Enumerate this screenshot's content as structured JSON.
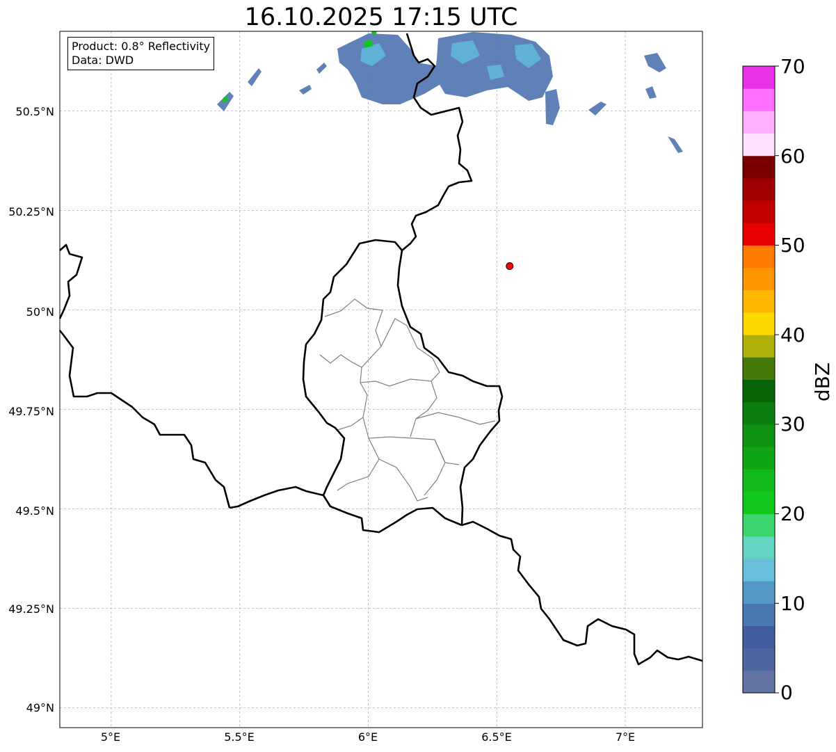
{
  "map": {
    "title": "16.10.2025 17:15 UTC",
    "info": {
      "product": "Product: 0.8° Reflectivity",
      "data": "Data: DWD"
    },
    "extent": {
      "lon_min": 4.8,
      "lon_max": 7.3,
      "lat_min": 48.95,
      "lat_max": 50.7
    },
    "gridlines": true,
    "lat_ticks": [
      {
        "value": 50.5,
        "label": "50.5°N"
      },
      {
        "value": 50.25,
        "label": "50.25°N"
      },
      {
        "value": 50.0,
        "label": "50°N"
      },
      {
        "value": 49.75,
        "label": "49.75°N"
      },
      {
        "value": 49.5,
        "label": "49.5°N"
      },
      {
        "value": 49.25,
        "label": "49.25°N"
      },
      {
        "value": 49.0,
        "label": "49°N"
      }
    ],
    "lon_ticks": [
      {
        "value": 5.0,
        "label": "5°E"
      },
      {
        "value": 5.5,
        "label": "5.5°E"
      },
      {
        "value": 6.0,
        "label": "6°E"
      },
      {
        "value": 6.5,
        "label": "6.5°E"
      },
      {
        "value": 7.0,
        "label": "7°E"
      }
    ],
    "marker": {
      "lon": 6.55,
      "lat": 50.11,
      "color": "#ff0000"
    },
    "colors": {
      "national_border": "#000000",
      "district_border": "#808080"
    }
  },
  "colorbar": {
    "unit": "dBZ",
    "min": 0,
    "max": 70,
    "ticks": [
      {
        "value": 0,
        "label": "0"
      },
      {
        "value": 10,
        "label": "10"
      },
      {
        "value": 20,
        "label": "20"
      },
      {
        "value": 30,
        "label": "30"
      },
      {
        "value": 40,
        "label": "40"
      },
      {
        "value": 50,
        "label": "50"
      },
      {
        "value": 60,
        "label": "60"
      },
      {
        "value": 70,
        "label": "70"
      }
    ],
    "colors": [
      "#6373a3",
      "#5066a0",
      "#425ea0",
      "#4a78b0",
      "#5499c6",
      "#67bfdc",
      "#64d5c3",
      "#3dd56e",
      "#12c71c",
      "#12bb1b",
      "#10a514",
      "#0f9111",
      "#0c7e0f",
      "#076409",
      "#467a08",
      "#b0b00a",
      "#ffd800",
      "#ffb800",
      "#ff9800",
      "#ff7a00",
      "#e60000",
      "#c20000",
      "#a00000",
      "#7a0000",
      "#ffe0ff",
      "#ffb0ff",
      "#ff70ff",
      "#e832e8"
    ]
  }
}
